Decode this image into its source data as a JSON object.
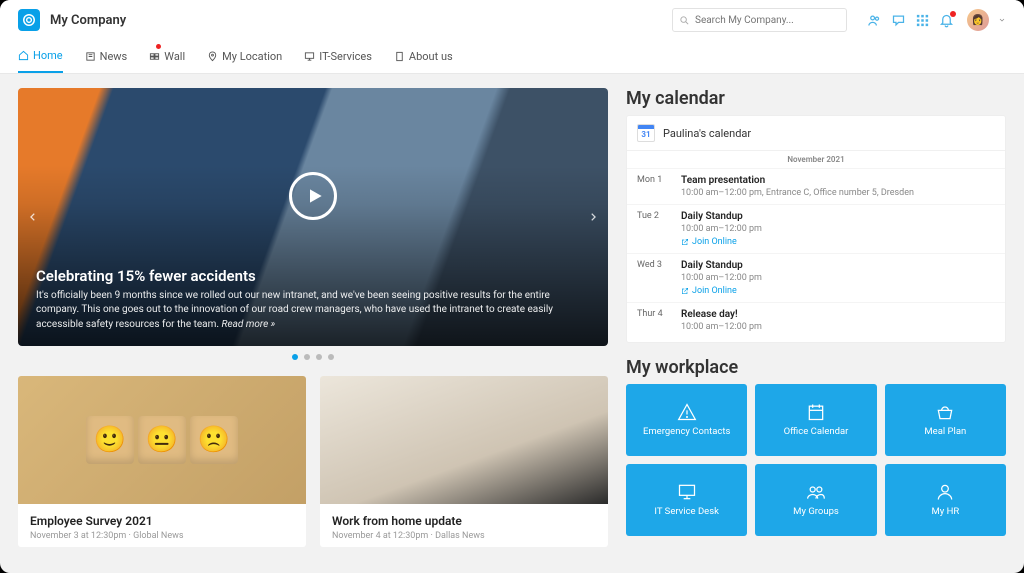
{
  "brand": "My Company",
  "search_placeholder": "Search My Company...",
  "nav": [
    {
      "label": "Home",
      "icon": "home"
    },
    {
      "label": "News",
      "icon": "news"
    },
    {
      "label": "Wall",
      "icon": "wall"
    },
    {
      "label": "My Location",
      "icon": "location"
    },
    {
      "label": "IT-Services",
      "icon": "monitor"
    },
    {
      "label": "About us",
      "icon": "building"
    }
  ],
  "hero": {
    "title": "Celebrating 15% fewer accidents",
    "body": "It's officially been 9 months since we rolled out our new intranet, and we've been seeing positive results for the entire company. This one goes out to the innovation of our road crew managers, who have used the intranet to create easily accessible safety resources for the team.",
    "read_more": "Read more »"
  },
  "cards": [
    {
      "title": "Employee Survey 2021",
      "meta": "November 3 at 12:30pm · Global News"
    },
    {
      "title": "Work from home update",
      "meta": "November 4 at 12:30pm · Dallas News"
    }
  ],
  "calendar": {
    "section": "My calendar",
    "name": "Paulina's calendar",
    "icon_num": "31",
    "month": "November 2021",
    "events": [
      {
        "day": "Mon 1",
        "title": "Team presentation",
        "detail": "10:00 am–12:00 pm, Entrance C, Office number 5, Dresden"
      },
      {
        "day": "Tue 2",
        "title": "Daily Standup",
        "detail": "10:00 am–12:00 pm",
        "join": "Join Online"
      },
      {
        "day": "Wed 3",
        "title": "Daily Standup",
        "detail": "10:00 am–12:00 pm",
        "join": "Join Online"
      },
      {
        "day": "Thur 4",
        "title": "Release day!",
        "detail": "10:00 am–12:00 pm"
      }
    ]
  },
  "workplace": {
    "section": "My workplace",
    "tiles": [
      {
        "label": "Emergency Contacts"
      },
      {
        "label": "Office Calendar"
      },
      {
        "label": "Meal Plan"
      },
      {
        "label": "IT Service Desk"
      },
      {
        "label": "My Groups"
      },
      {
        "label": "My HR"
      }
    ]
  }
}
